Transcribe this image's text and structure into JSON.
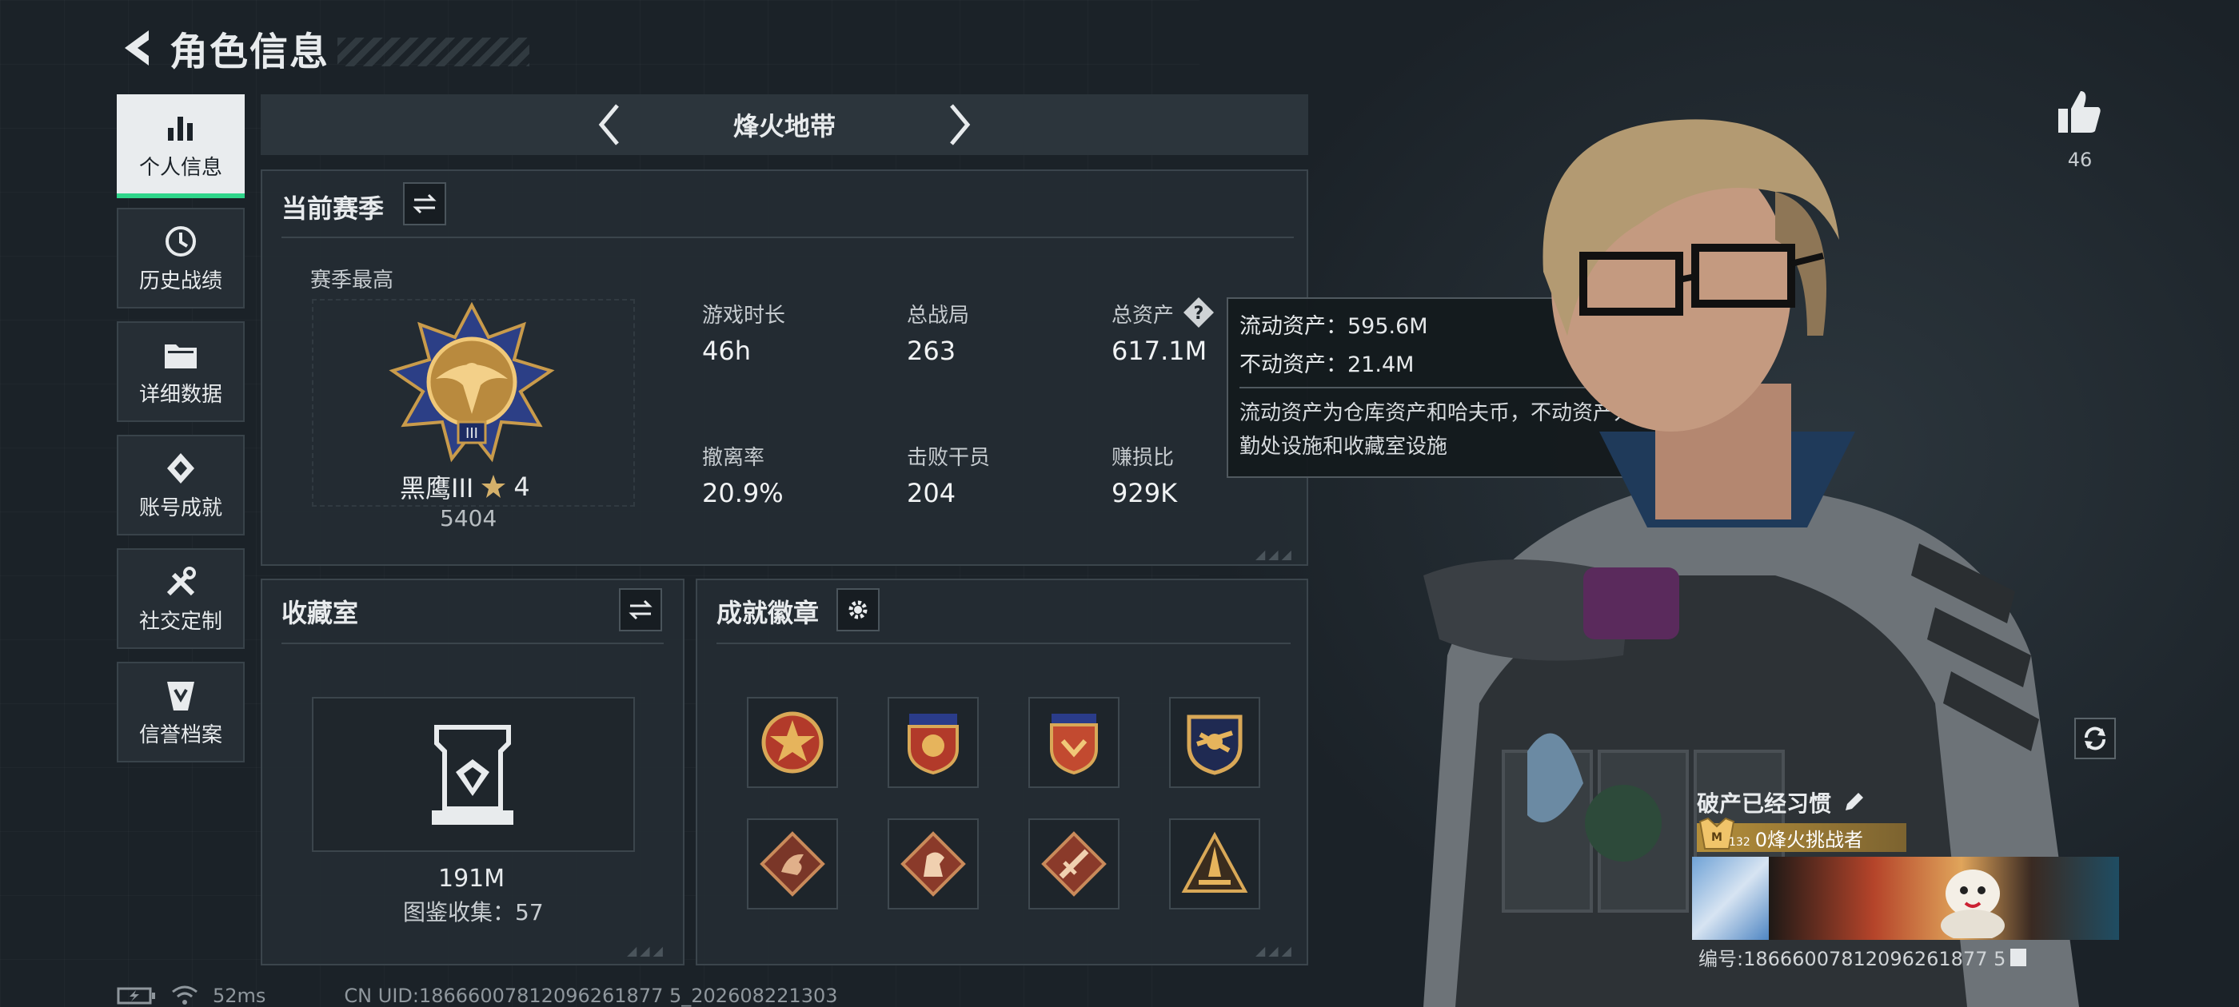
{
  "header": {
    "title": "角色信息"
  },
  "sidebar": {
    "items": [
      {
        "label": "个人信息",
        "icon": "bar-chart-icon",
        "active": true
      },
      {
        "label": "历史战绩",
        "icon": "history-clock-icon",
        "active": false
      },
      {
        "label": "详细数据",
        "icon": "folder-icon",
        "active": false
      },
      {
        "label": "账号成就",
        "icon": "achievement-icon",
        "active": false
      },
      {
        "label": "社交定制",
        "icon": "tools-icon",
        "active": false
      },
      {
        "label": "信誉档案",
        "icon": "reputation-icon",
        "active": false
      }
    ]
  },
  "season_selector": {
    "name": "烽火地带"
  },
  "current_season": {
    "title": "当前赛季",
    "rank_label": "赛季最高",
    "rank_name": "黑鹰III",
    "rank_stars": "4",
    "rank_score": "5404",
    "stats": [
      {
        "label": "游戏时长",
        "value": "46h"
      },
      {
        "label": "总战局",
        "value": "263"
      },
      {
        "label": "总资产",
        "value": "617.1M"
      },
      {
        "label": "撤离率",
        "value": "20.9%"
      },
      {
        "label": "击败干员",
        "value": "204"
      },
      {
        "label": "赚损比",
        "value": "929K"
      }
    ]
  },
  "tooltip": {
    "liquid": "流动资产：595.6M",
    "fixed": "不动资产：21.4M",
    "description": "流动资产为仓库资产和哈夫币，不动资产为特勤处设施和收藏室设施"
  },
  "collection": {
    "title": "收藏室",
    "value": "191M",
    "count_text": "图鉴收集：57"
  },
  "achievements": {
    "title": "成就徽章",
    "badges": [
      "red-star-shield-icon",
      "blue-star-shield-icon",
      "red-wing-shield-icon",
      "gold-eagle-shield-icon",
      "dragon-diamond-icon",
      "horse-diamond-icon",
      "sword-diamond-icon",
      "rocket-triangle-icon"
    ]
  },
  "profile": {
    "likes": "46",
    "player_name": "破产已经习惯",
    "title_level": "132",
    "title_text": "0烽火挑战者",
    "uid_text": "编号:18666007812096261877 5"
  },
  "status_bar": {
    "ping": "52ms",
    "uid": "CN UID:18666007812096261877 5_202608221303"
  },
  "colors": {
    "accent": "#2fd58a",
    "panel": "#242c33",
    "border": "#3b454c"
  }
}
